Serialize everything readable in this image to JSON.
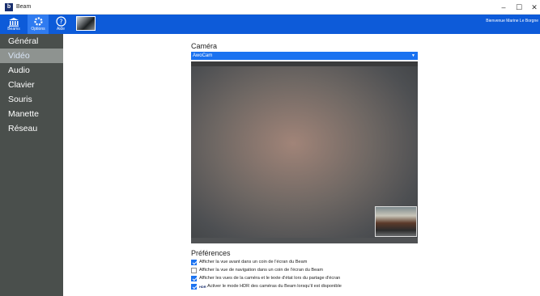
{
  "window": {
    "title": "Beam",
    "logo_letter": "b",
    "minimize": "–",
    "maximize": "☐",
    "close": "✕"
  },
  "toolbar": {
    "items": [
      {
        "label": "Beams",
        "icon": "building-icon",
        "glyph": "🏛"
      },
      {
        "label": "Options",
        "icon": "gear-icon",
        "glyph": "⚙"
      },
      {
        "label": "Aide",
        "icon": "help-icon",
        "glyph": "?"
      }
    ],
    "welcome": "Bienvenue Marine Le Borgne"
  },
  "sidebar": {
    "items": [
      {
        "label": "Général"
      },
      {
        "label": "Vidéo",
        "active": true
      },
      {
        "label": "Audio"
      },
      {
        "label": "Clavier"
      },
      {
        "label": "Souris"
      },
      {
        "label": "Manette"
      },
      {
        "label": "Réseau"
      }
    ]
  },
  "camera": {
    "title": "Caméra",
    "selected": "AwoCam"
  },
  "preferences": {
    "title": "Préférences",
    "items": [
      {
        "label": "Afficher la vue avant dans un coin de l'écran du Beam",
        "checked": true
      },
      {
        "label": "Afficher la vue de navigation dans un coin de l'écran du Beam",
        "checked": false
      },
      {
        "label": "Afficher les vues de la caméra et le texte d'état lors du partage d'écran",
        "checked": true
      },
      {
        "label": "Activer le mode HDR des caméras du Beam lorsqu'il est disponible",
        "checked": true,
        "badge": "HDR"
      }
    ]
  }
}
